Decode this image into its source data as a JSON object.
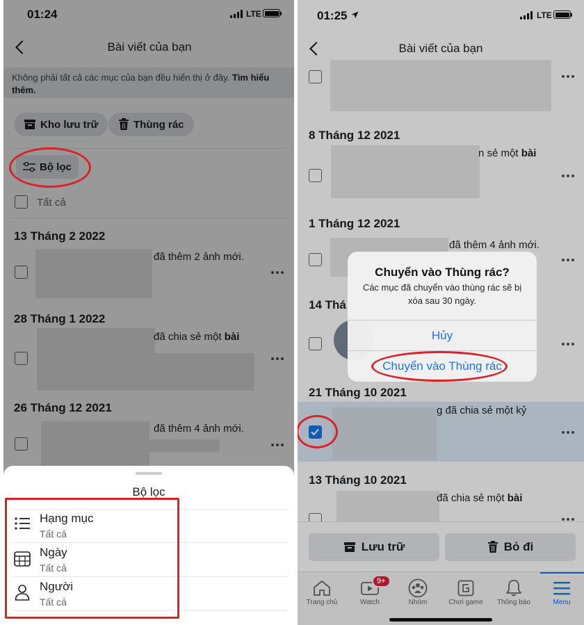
{
  "left": {
    "status": {
      "time": "01:24",
      "network": "LTE"
    },
    "header": {
      "title": "Bài viết của bạn"
    },
    "notice": {
      "text": "Không phải tất cả các mục của bạn đều hiển thị ở đây. ",
      "link": "Tìm hiểu thêm."
    },
    "buttons": {
      "archive": "Kho lưu trữ",
      "trash": "Thùng rác",
      "filter": "Bộ lọc"
    },
    "select_all": "Tất cả",
    "groups": [
      {
        "date": "13 Tháng 2 2022",
        "post_text": "đã thêm 2 ảnh mới."
      },
      {
        "date": "28 Tháng 1 2022",
        "post_text": "đã chia sẻ một ",
        "post_bold": "bài"
      },
      {
        "date": "26 Tháng 12 2021",
        "post_text": "đã thêm 4 ảnh mới."
      }
    ],
    "filter_sheet": {
      "title": "Bộ lọc",
      "options": [
        {
          "label": "Hạng mục",
          "value": "Tất cả",
          "icon": "list-icon"
        },
        {
          "label": "Ngày",
          "value": "Tất cả",
          "icon": "calendar-icon"
        },
        {
          "label": "Người",
          "value": "Tất cả",
          "icon": "person-icon"
        }
      ]
    },
    "annotation_color": "#d8232a"
  },
  "right": {
    "status": {
      "time": "01:25",
      "network": "LTE"
    },
    "header": {
      "title": "Bài viết của bạn"
    },
    "groups": [
      {
        "date": "8 Tháng 12 2021",
        "post_text": "n sẻ một ",
        "post_bold": "bài"
      },
      {
        "date": "1 Tháng 12 2021",
        "post_text": "đã thêm 4 ảnh mới."
      },
      {
        "date": "14 Thá"
      },
      {
        "date": "21 Tháng 10 2021",
        "post_text": "g đã chia sẻ một kỷ"
      },
      {
        "date": "13 Tháng 10 2021",
        "post_text": "đã chia sẻ một ",
        "post_bold": "bài"
      }
    ],
    "dialog": {
      "title": "Chuyển vào Thùng rác?",
      "message": "Các mục đã chuyển vào thùng rác sẽ bị xóa sau 30 ngày.",
      "cancel": "Hủy",
      "confirm": "Chuyển vào Thùng rác"
    },
    "actions": {
      "archive": "Lưu trữ",
      "delete": "Bỏ đi"
    },
    "tabbar": [
      {
        "label": "Trang chủ",
        "icon": "home-icon"
      },
      {
        "label": "Watch",
        "icon": "watch-icon",
        "badge": "9+"
      },
      {
        "label": "Nhóm",
        "icon": "groups-icon"
      },
      {
        "label": "Chơi game",
        "icon": "gaming-icon"
      },
      {
        "label": "Thông báo",
        "icon": "bell-icon"
      },
      {
        "label": "Menu",
        "icon": "menu-icon",
        "active": true
      }
    ],
    "accent": "#1b74e4",
    "annotation_color": "#d8232a"
  }
}
